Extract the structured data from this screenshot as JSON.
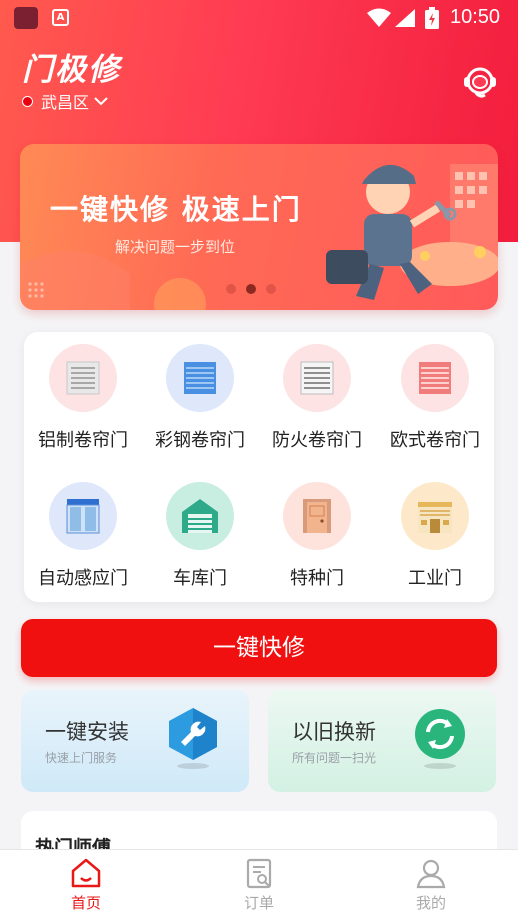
{
  "status_bar": {
    "time": "10:50"
  },
  "header": {
    "app_title": "门极修",
    "location": "武昌区"
  },
  "banner": {
    "title": "一键快修  极速上门",
    "subtitle": "解决问题一步到位"
  },
  "categories": [
    {
      "label": "铝制卷帘门",
      "icon": "aluminum-shutter-icon"
    },
    {
      "label": "彩钢卷帘门",
      "icon": "color-steel-shutter-icon"
    },
    {
      "label": "防火卷帘门",
      "icon": "fireproof-shutter-icon"
    },
    {
      "label": "欧式卷帘门",
      "icon": "european-shutter-icon"
    },
    {
      "label": "自动感应门",
      "icon": "automatic-door-icon"
    },
    {
      "label": "车库门",
      "icon": "garage-door-icon"
    },
    {
      "label": "特种门",
      "icon": "special-door-icon"
    },
    {
      "label": "工业门",
      "icon": "industrial-door-icon"
    }
  ],
  "quick_repair": {
    "label": "一键快修"
  },
  "services": {
    "install": {
      "title": "一键安装",
      "subtitle": "快速上门服务",
      "icon": "wrench-icon"
    },
    "replace": {
      "title": "以旧换新",
      "subtitle": "所有问题一扫光",
      "icon": "refresh-icon"
    }
  },
  "hot": {
    "title": "热门师傅"
  },
  "tabbar": [
    {
      "label": "首页",
      "icon": "home-icon",
      "active": true
    },
    {
      "label": "订单",
      "icon": "order-icon",
      "active": false
    },
    {
      "label": "我的",
      "icon": "profile-icon",
      "active": false
    }
  ],
  "colors": {
    "primary": "#f01010",
    "header": "#ff3b53",
    "tab_active": "#e81818"
  }
}
